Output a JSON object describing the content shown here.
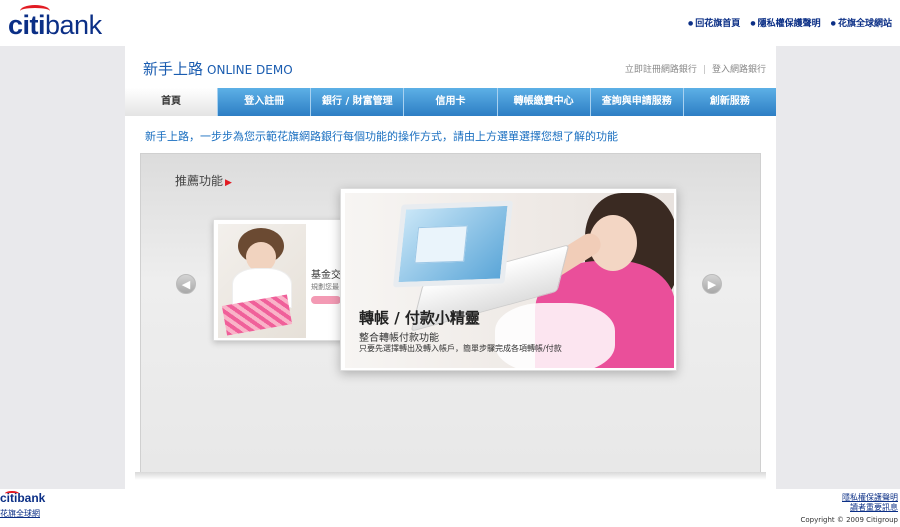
{
  "brand": {
    "logo_part1": "citi",
    "logo_part2": "bank"
  },
  "top_links": [
    "回花旗首頁",
    "隱私權保護聲明",
    "花旗全球網站"
  ],
  "header": {
    "title_zh": "新手上路",
    "title_en": "ONLINE DEMO",
    "link_register": "立即註冊網路銀行",
    "link_login": "登入網路銀行",
    "separator": "|"
  },
  "nav": {
    "items": [
      {
        "label": "首頁",
        "active": true
      },
      {
        "label": "登入註冊",
        "active": false
      },
      {
        "label": "銀行 / 財富管理",
        "active": false
      },
      {
        "label": "信用卡",
        "active": false
      },
      {
        "label": "轉帳繳費中心",
        "active": false
      },
      {
        "label": "查詢與申請服務",
        "active": false
      },
      {
        "label": "創新服務",
        "active": false
      }
    ]
  },
  "intro": "新手上路，一步步為您示範花旗網路銀行每個功能的操作方式，請由上方選單選擇您想了解的功能",
  "recommend": {
    "title": "推薦功能",
    "title_arrow": "▶",
    "prev_symbol": "◀",
    "next_symbol": "▶"
  },
  "back_card": {
    "title": "基金交",
    "subtitle": "規劃您最"
  },
  "front_card": {
    "title": "轉帳 / 付款小精靈",
    "subtitle": "整合轉帳付款功能",
    "description": "只要先選擇轉出及轉入帳戶，簡單步驟完成各項轉帳/付款"
  },
  "footer": {
    "logo_part1": "citi",
    "logo_part2": "bank",
    "left_link": "花旗全球網",
    "right_links": [
      "隱私權保護聲明",
      "讀者重要訊息"
    ],
    "copyright": "Copyright © 2009 Citigroup"
  },
  "colors": {
    "brand_blue": "#0b2f86",
    "brand_red": "#e21b23",
    "nav_blue": "#2d7ec4",
    "accent_pink": "#ea4f9a"
  }
}
